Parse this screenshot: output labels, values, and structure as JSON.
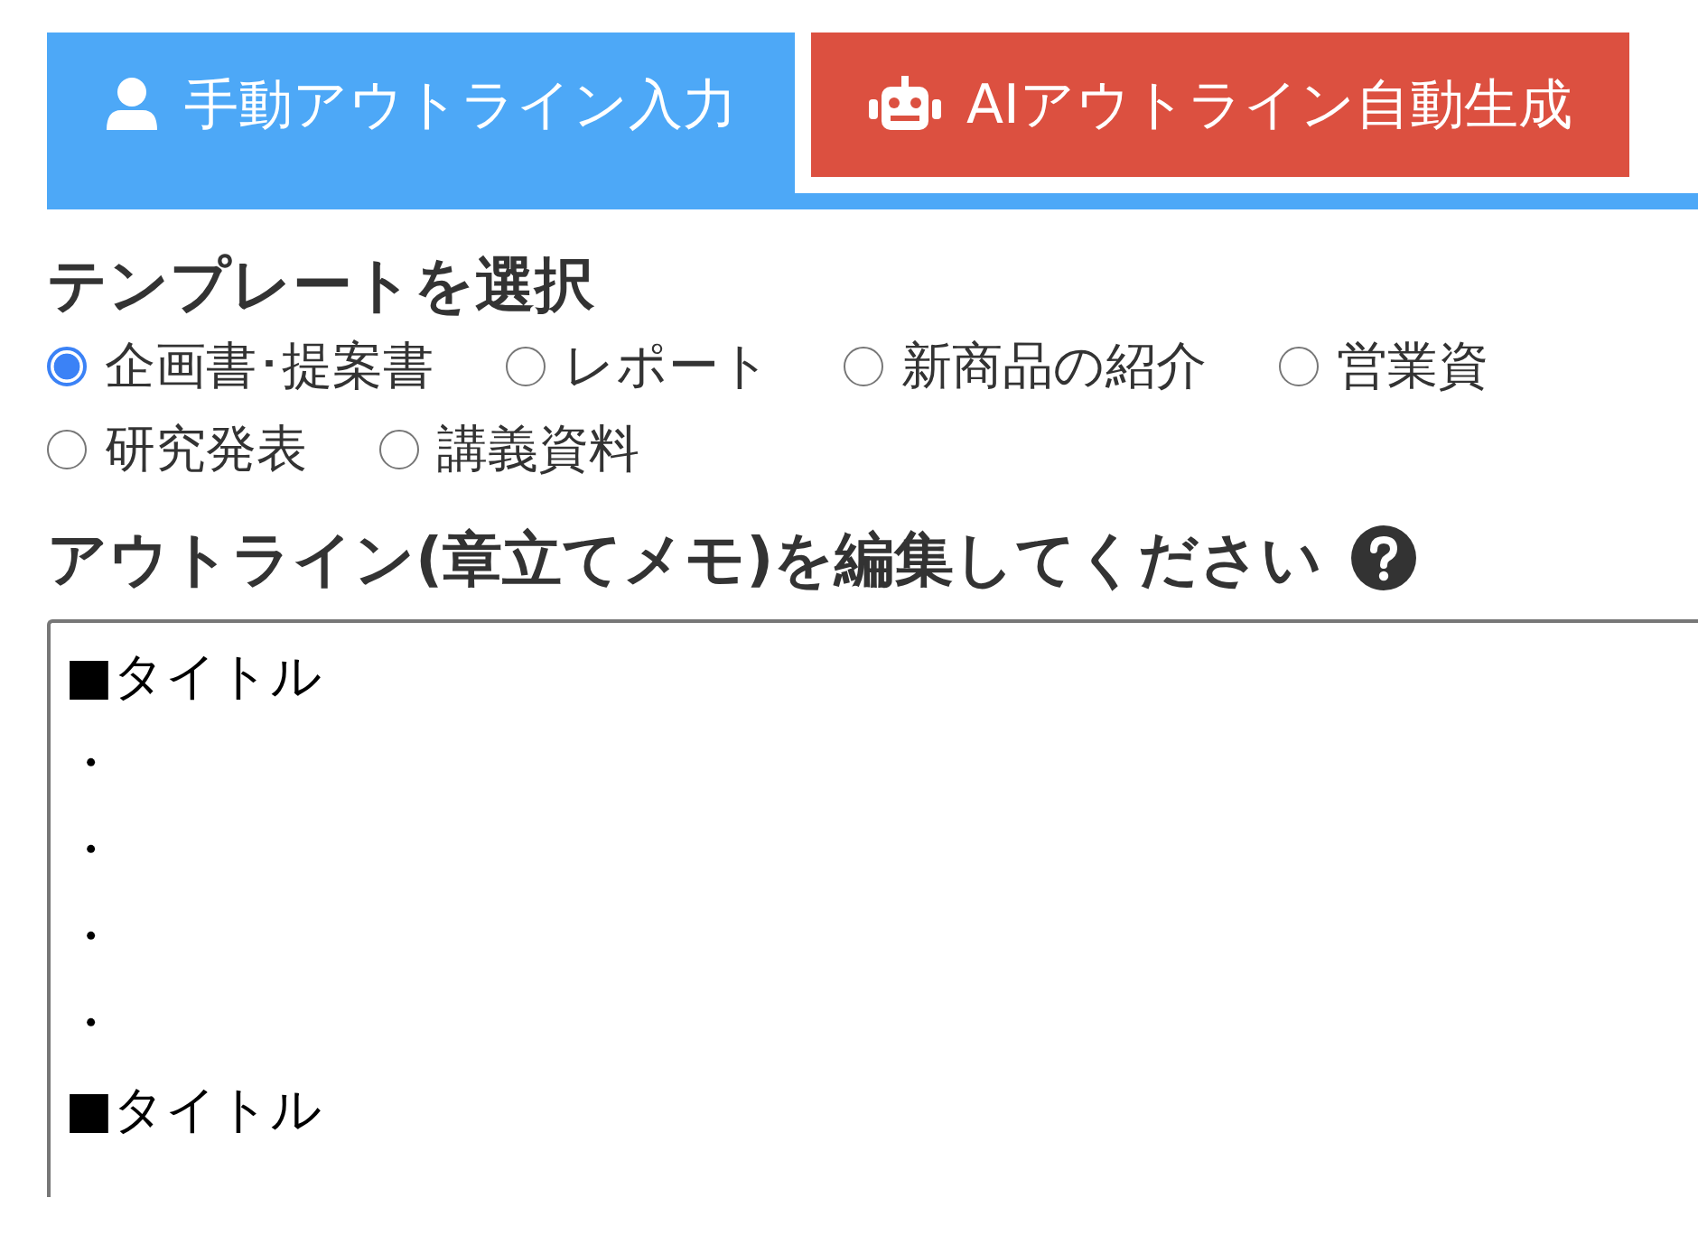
{
  "tabs": [
    {
      "label": "手動アウトライン入力",
      "selected": true,
      "color": "#4da8f7"
    },
    {
      "label": "AIアウトライン自動生成",
      "selected": false,
      "color": "#dc5040"
    }
  ],
  "template": {
    "heading": "テンプレートを選択",
    "options": [
      {
        "label": "企画書･提案書",
        "selected": true
      },
      {
        "label": "レポート",
        "selected": false
      },
      {
        "label": "新商品の紹介",
        "selected": false
      },
      {
        "label": "営業資",
        "selected": false
      },
      {
        "label": "研究発表",
        "selected": false
      },
      {
        "label": "講義資料",
        "selected": false
      }
    ]
  },
  "outline": {
    "heading": "アウトライン(章立てメモ)を編集してください",
    "lines": [
      "■タイトル",
      "・",
      "・",
      "・",
      "・",
      "■タイトル"
    ]
  }
}
